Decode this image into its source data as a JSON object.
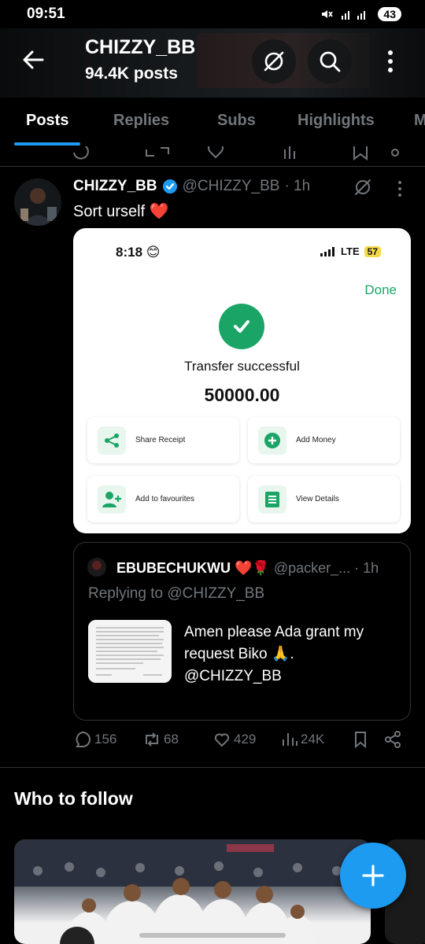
{
  "status_bar": {
    "time": "09:51",
    "battery": "43"
  },
  "header": {
    "name": "CHIZZY_BB",
    "posts": "94.4K posts"
  },
  "tabs": [
    {
      "label": "Posts"
    },
    {
      "label": "Replies"
    },
    {
      "label": "Subs"
    },
    {
      "label": "Highlights"
    },
    {
      "label": "M"
    }
  ],
  "tweet": {
    "name": "CHIZZY_BB",
    "handle": "@CHIZZY_BB",
    "time": "· 1h",
    "text": "Sort urself ❤️",
    "receipt": {
      "time": "8:18 😊",
      "network": "LTE",
      "battery": "57",
      "done": "Done",
      "message": "Transfer successful",
      "amount": "50000.00",
      "actions": [
        {
          "label": "Share Receipt",
          "icon": "share-icon"
        },
        {
          "label": "Add Money",
          "icon": "add-circle-icon"
        },
        {
          "label": "Add to favourites",
          "icon": "add-person-icon"
        },
        {
          "label": "View Details",
          "icon": "list-icon"
        }
      ]
    },
    "quote": {
      "name": "EBUBECHUKWU ❤️🌹",
      "handle": "@packer_...",
      "time": "· 1h",
      "replying_prefix": "Replying to",
      "replying_to": "@CHIZZY_BB",
      "text": "Amen please Ada grant my request Biko 🙏.",
      "mention": "@CHIZZY_BB"
    },
    "stats": {
      "replies": "156",
      "reposts": "68",
      "likes": "429",
      "views": "24K"
    }
  },
  "who_to_follow": {
    "title": "Who to follow"
  },
  "colors": {
    "accent": "#1d9bf0",
    "success": "#1aa566",
    "background": "#000000",
    "muted": "#71767b"
  }
}
